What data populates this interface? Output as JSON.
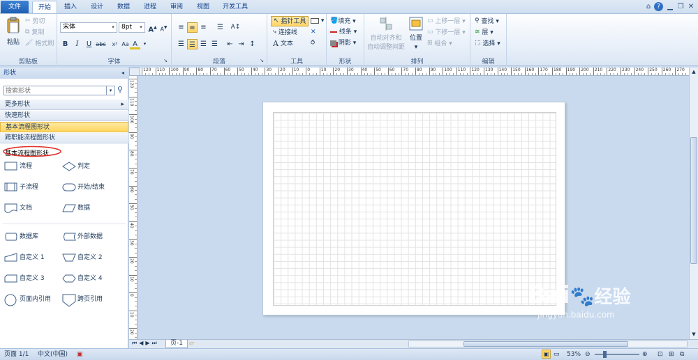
{
  "tabs": [
    {
      "label": "文件",
      "name": "tab-file"
    },
    {
      "label": "开始",
      "name": "tab-home"
    },
    {
      "label": "插入",
      "name": "tab-insert"
    },
    {
      "label": "设计",
      "name": "tab-design"
    },
    {
      "label": "数据",
      "name": "tab-data"
    },
    {
      "label": "进程",
      "name": "tab-process"
    },
    {
      "label": "审阅",
      "name": "tab-review"
    },
    {
      "label": "视图",
      "name": "tab-view"
    },
    {
      "label": "开发工具",
      "name": "tab-developer"
    }
  ],
  "clipboard": {
    "paste": "粘贴",
    "cut": "剪切",
    "copy": "复制",
    "format_painter": "格式刷",
    "label": "剪贴板"
  },
  "font": {
    "family": "宋体",
    "size": "8pt",
    "label": "字体"
  },
  "paragraph": {
    "label": "段落"
  },
  "tools": {
    "pointer": "指针工具",
    "connector": "连接线",
    "text": "文本",
    "label": "工具"
  },
  "shape_group": {
    "fill": "填充",
    "line": "线条",
    "shadow": "阴影",
    "label": "形状"
  },
  "arrange": {
    "auto_align_1": "自动对齐和",
    "auto_align_2": "自动调整间距",
    "position": "位置",
    "bring_forward": "上移一层",
    "send_backward": "下移一层",
    "group": "组合",
    "label": "排列"
  },
  "editing": {
    "find": "查找",
    "layer": "层",
    "select": "选择",
    "label": "编辑"
  },
  "panel": {
    "title": "形状",
    "search_placeholder": "搜索形状",
    "more_shapes": "更多形状",
    "quick_shapes": "快速形状",
    "basic_flowchart": "基本流程图形状",
    "cross_functional": "跨职能流程图形状",
    "stencil_title": "基本流程图形状",
    "shapes": [
      "流程",
      "判定",
      "子流程",
      "开始/结束",
      "文档",
      "数据",
      "数据库",
      "外部数据",
      "自定义 1",
      "自定义 2",
      "自定义 3",
      "自定义 4",
      "页面内引用",
      "跨页引用"
    ]
  },
  "ruler": {
    "h_labels": [
      "120",
      "110",
      "100",
      "90",
      "80",
      "70",
      "60",
      "50",
      "40",
      "30",
      "20",
      "10",
      "0",
      "10",
      "20",
      "30",
      "40",
      "50",
      "60",
      "70",
      "80",
      "90",
      "100",
      "110",
      "120",
      "130",
      "140",
      "150",
      "160",
      "170",
      "180",
      "190",
      "200",
      "210",
      "220",
      "230",
      "240",
      "250",
      "260",
      "270"
    ],
    "v_labels": [
      "120",
      "110",
      "100",
      "90",
      "80",
      "70",
      "60",
      "50",
      "40",
      "30",
      "20",
      "10",
      "0",
      "10",
      "20"
    ]
  },
  "page_tab": "页-1",
  "status": {
    "page": "页面 1/1",
    "language": "中文(中国)",
    "zoom": "53%"
  },
  "watermark": {
    "brand": "Bai",
    "brand2": "经验",
    "url": "jingyan.baidu.com"
  }
}
